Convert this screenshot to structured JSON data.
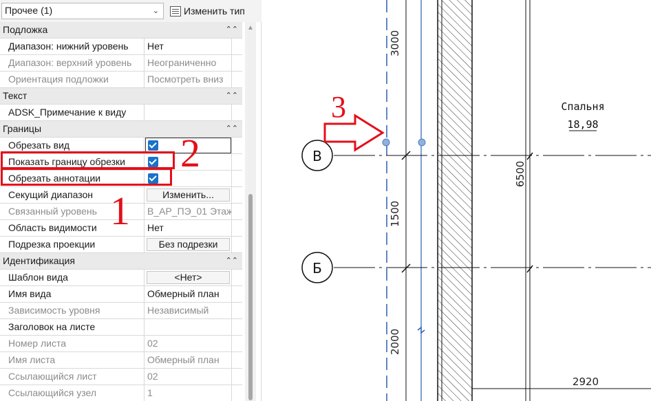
{
  "type_selector": {
    "value": "Прочее (1)",
    "edit_type_label": "Изменить тип"
  },
  "groups": {
    "underlay": "Подложка",
    "text": "Текст",
    "extents": "Границы",
    "identity": "Идентификация"
  },
  "rows": [
    {
      "label": "Диапазон: нижний уровень",
      "value": "Нет"
    },
    {
      "label": "Диапазон: верхний уровень",
      "value": "Неограниченно"
    },
    {
      "label": "Ориентация подложки",
      "value": "Посмотреть вниз"
    },
    {
      "label": "ADSK_Примечание к виду",
      "value": ""
    },
    {
      "label": "Обрезать вид",
      "value": ""
    },
    {
      "label": "Показать границу обрезки",
      "value": ""
    },
    {
      "label": "Обрезать аннотации",
      "value": ""
    },
    {
      "label": "Секущий диапазон",
      "value": "Изменить..."
    },
    {
      "label": "Связанный уровень",
      "value": "В_АР_ПЭ_01 Этаж"
    },
    {
      "label": "Область видимости",
      "value": "Нет"
    },
    {
      "label": "Подрезка проекции",
      "value": "Без подрезки"
    },
    {
      "label": "Шаблон вида",
      "value": "<Нет>"
    },
    {
      "label": "Имя вида",
      "value": "Обмерный план"
    },
    {
      "label": "Зависимость уровня",
      "value": "Независимый"
    },
    {
      "label": "Заголовок на листе",
      "value": ""
    },
    {
      "label": "Номер листа",
      "value": "02"
    },
    {
      "label": "Имя листа",
      "value": "Обмерный план"
    },
    {
      "label": "Ссылающийся лист",
      "value": "02"
    },
    {
      "label": "Ссылающийся узел",
      "value": "1"
    }
  ],
  "checkboxes": {
    "crop_view": true,
    "crop_region_visible": true,
    "annotation_crop": true
  },
  "annotations": {
    "num1": "1",
    "num2": "2",
    "num3": "3",
    "color": "#e3101a"
  },
  "drawing": {
    "grid_b": "В",
    "grid_be": "Б",
    "dim_3000": "3000",
    "dim_1500": "1500",
    "dim_2000": "2000",
    "dim_6500": "6500",
    "dim_2920": "2920",
    "room_name": "Спальня",
    "room_area": "18,98"
  }
}
